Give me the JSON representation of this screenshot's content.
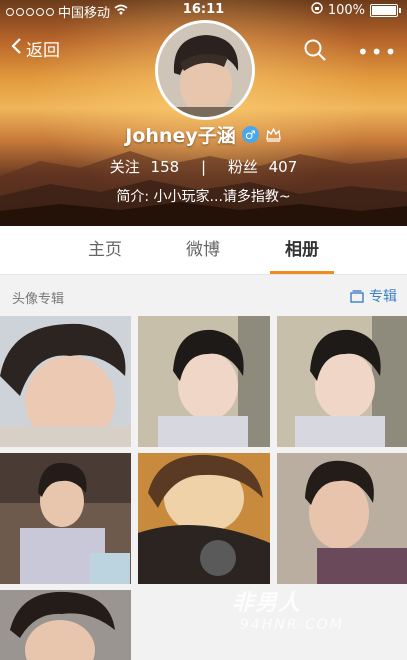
{
  "status_bar": {
    "carrier": "中国移动",
    "time": "16:11",
    "battery": "100%"
  },
  "nav": {
    "back_label": "返回",
    "more_label": "•••"
  },
  "profile": {
    "name": "Johney子涵",
    "gender_symbol": "♂",
    "following_label": "关注",
    "following_count": "158",
    "separator": "|",
    "followers_label": "粉丝",
    "followers_count": "407",
    "intro": "简介: 小小玩家...请多指教~"
  },
  "tabs": [
    {
      "label": "主页"
    },
    {
      "label": "微博"
    },
    {
      "label": "相册"
    }
  ],
  "album": {
    "section_title": "头像专辑",
    "album_button_label": "专辑"
  },
  "watermark": {
    "text": "非男人",
    "url": "94HNR·COM"
  },
  "colors": {
    "accent": "#f08c1e",
    "link": "#3a80c7"
  }
}
